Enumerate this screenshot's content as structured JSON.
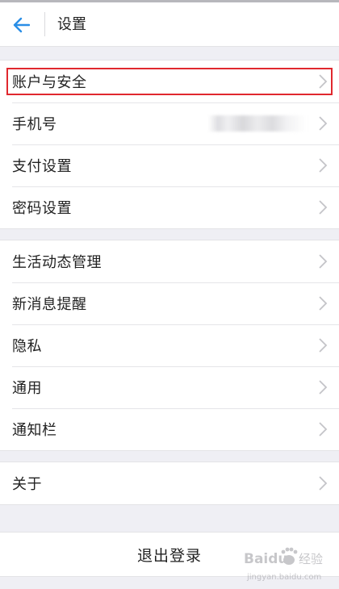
{
  "header": {
    "title": "设置",
    "back_icon": "arrow-left-icon",
    "accent": "#2a8ee6"
  },
  "groups": [
    {
      "items": [
        {
          "id": "account-security",
          "label": "账户与安全",
          "highlighted": true
        },
        {
          "id": "phone",
          "label": "手机号",
          "value_blurred": true
        },
        {
          "id": "payment",
          "label": "支付设置"
        },
        {
          "id": "password",
          "label": "密码设置"
        }
      ]
    },
    {
      "items": [
        {
          "id": "moments-manage",
          "label": "生活动态管理"
        },
        {
          "id": "new-message-alert",
          "label": "新消息提醒"
        },
        {
          "id": "privacy",
          "label": "隐私"
        },
        {
          "id": "general",
          "label": "通用"
        },
        {
          "id": "notification-bar",
          "label": "通知栏"
        }
      ]
    },
    {
      "items": [
        {
          "id": "about",
          "label": "关于"
        }
      ]
    }
  ],
  "logout_label": "退出登录",
  "highlight_color": "#e0282e",
  "watermark": {
    "brand": "Baidu",
    "text": "经验",
    "url": "jingyan.baidu.com"
  }
}
